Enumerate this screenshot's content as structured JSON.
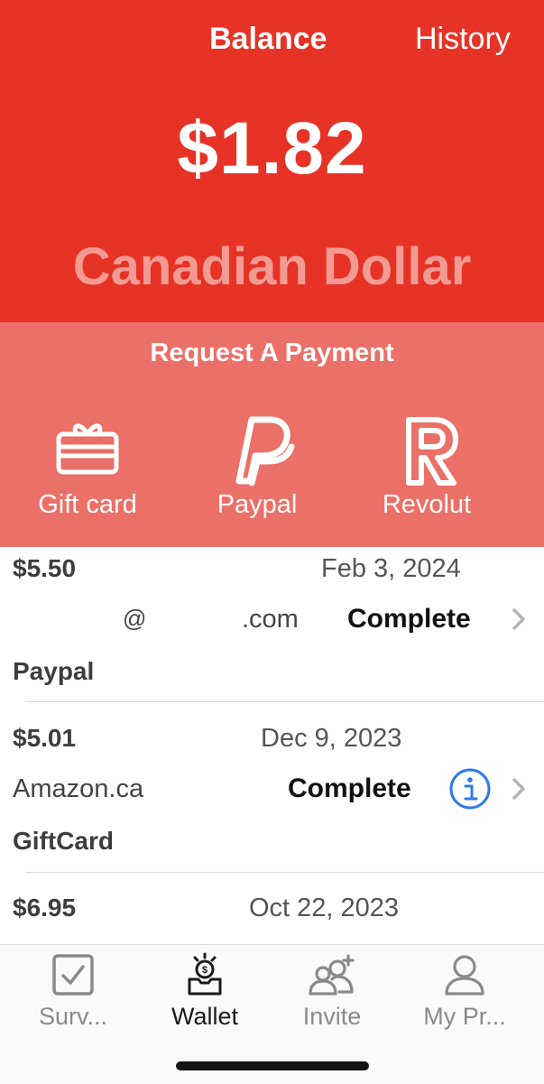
{
  "header": {
    "tabs": [
      {
        "label": "Balance",
        "active": true
      },
      {
        "label": "History",
        "active": false
      }
    ],
    "balance_amount": "$1.82",
    "currency": "Canadian Dollar",
    "colors": {
      "primary": "#e63326",
      "secondary": "#eb7068",
      "currency_text": "#f39b93"
    }
  },
  "request": {
    "title": "Request A Payment",
    "methods": [
      {
        "label": "Gift card",
        "icon": "gift-card-icon"
      },
      {
        "label": "Paypal",
        "icon": "paypal-icon"
      },
      {
        "label": "Revolut",
        "icon": "revolut-icon"
      }
    ]
  },
  "transactions": [
    {
      "amount": "$5.50",
      "date": "Feb 3, 2024",
      "destination_at": "@",
      "destination_domain": ".com",
      "status": "Complete",
      "method": "Paypal",
      "has_info": false
    },
    {
      "amount": "$5.01",
      "date": "Dec 9, 2023",
      "destination": "Amazon.ca",
      "status": "Complete",
      "method": "GiftCard",
      "has_info": true
    },
    {
      "amount": "$6.95",
      "date": "Oct 22, 2023"
    }
  ],
  "tabbar": {
    "items": [
      {
        "label": "Surv...",
        "icon": "survey-checkbox-icon",
        "active": false
      },
      {
        "label": "Wallet",
        "icon": "wallet-icon",
        "active": true
      },
      {
        "label": "Invite",
        "icon": "invite-users-icon",
        "active": false
      },
      {
        "label": "My Pr...",
        "icon": "profile-icon",
        "active": false
      }
    ]
  }
}
